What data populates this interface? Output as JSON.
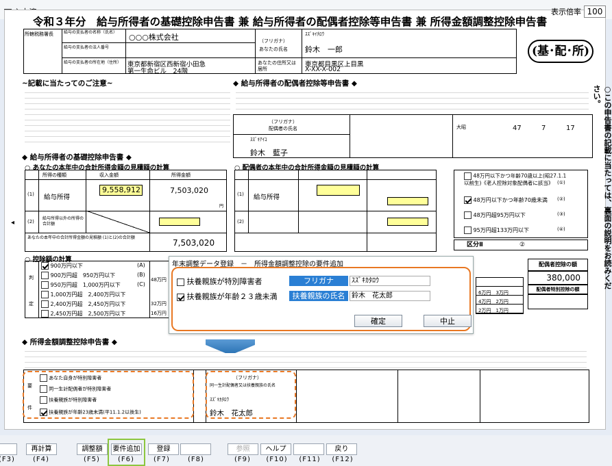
{
  "topbar": {
    "input_done_label": "入力済",
    "zoom_label": "表示倍率",
    "zoom_value": "100"
  },
  "form": {
    "title": "令和３年分　給与所得者の基礎控除申告書 兼 給与所得者の配偶者控除等申告書 兼 所得金額調整控除申告書",
    "badge": "(基･配･所)",
    "office_label": "所轄税務署長",
    "payer_name_label": "給与の支払者の名称（氏名）",
    "payer_name": "○○○株式会社",
    "payer_corp_label": "給与の支払者の法人番号",
    "payer_addr_label": "給与の支払者の所在地（住所）",
    "payer_addr_1": "東京都新宿区西新宿小田急",
    "payer_addr_2": "第一生命ビル　24階",
    "furigana_label": "（フリガナ）",
    "name_label": "あなたの氏名",
    "name_kana": "ｽｽﾞｷｲﾁﾛｳ",
    "name": "鈴木　一郎",
    "your_addr_label": "あなたの住所又は居所",
    "your_addr_1": "東京都目黒区上目黒",
    "your_addr_2": "X-XX-X-002",
    "notes_title": "~記載に当たってのご注意~",
    "spouse_title": "◆ 給与所得者の配偶者控除等申告書 ◆",
    "basic_title": "◆ 給与所得者の基礎控除申告書 ◆",
    "estimate_title": "○ あなたの本年中の合計所得金額の見積額の計算",
    "spouse_estimate_title": "○ 配偶者の本年中の合計所得金額の見積額の計算",
    "income_type_hdr": "所得の種類",
    "revenue_hdr": "収入金額",
    "income_hdr": "所得金額",
    "row1_label": "給与所得",
    "row1_revenue": "9,558,912",
    "row1_income": "7,503,020",
    "row2_label": "給与所得以外の所得の合計額",
    "total_label": "あなたの本年中の合計所得金額の見積額 (1)と(2)の合計額",
    "total_value": "7,503,020",
    "deduction_title": "○ 控除額の計算",
    "deduction_rows": [
      {
        "check": true,
        "text": "900万円以下",
        "mark": "(A)"
      },
      {
        "check": false,
        "text": "900万円超　950万円以下",
        "mark": "(B)"
      },
      {
        "check": false,
        "text": "950万円超　1,000万円以下",
        "mark": "(C)"
      },
      {
        "check": false,
        "text": "1,000万円超　2,400万円以下",
        "mark": ""
      },
      {
        "check": false,
        "text": "2,400万円超　2,450万円以下",
        "mark": ""
      },
      {
        "check": false,
        "text": "2,450万円超　2,500万円以下",
        "mark": ""
      }
    ],
    "deduction_amounts": [
      "48万円",
      "32万円",
      "16万円"
    ],
    "spouse_kana": "ｽｽﾞｷｱｲｺ",
    "spouse_name": "鈴木　藍子",
    "spouse_name_label": "配偶者の氏名",
    "spouse_birth_era": "大昭",
    "spouse_birth_year": "47",
    "spouse_birth_month": "7",
    "spouse_birth_day": "17",
    "spouse_cats": [
      {
        "check": false,
        "text": "48万円以下かつ年齢70歳以上(昭27.1.1以前生)《老人控除対象配偶者に該当》",
        "mark": "(①)"
      },
      {
        "check": true,
        "text": "48万円以下かつ年齢70歳未満",
        "mark": "(②)"
      },
      {
        "check": false,
        "text": "48万円超95万円以下",
        "mark": "(③)"
      },
      {
        "check": false,
        "text": "95万円超133万円以下",
        "mark": "(④)"
      }
    ],
    "kubun_label": "区分Ⅱ",
    "kubun_value": "②",
    "spouse_deduction_label": "配偶者控除の額",
    "spouse_deduction_value": "380,000",
    "spouse_special_label": "配偶者特別控除の額",
    "adj_title": "◆ 所得金額調整控除申告書 ◆",
    "adj_reqs": [
      {
        "check": false,
        "text": "あなた自身が特別障害者"
      },
      {
        "check": false,
        "text": "同一生計配偶者が特別障害者"
      },
      {
        "check": false,
        "text": "扶養親族が特別障害者"
      },
      {
        "check": true,
        "text": "扶養親族が年齢23歳未満(平11.1.2以後生)"
      }
    ],
    "dependent_kana": "ｽｽﾞｷｶﾀﾛｳ",
    "dependent_name": "鈴木　花太郎",
    "dependent_box_label": "同一生計配偶者又は扶養親族の氏名",
    "yen": "円",
    "vertical_note": "○この申告書の記載に当たっては、裏面の説明をお読みください。"
  },
  "dialog": {
    "title": "年末調整データ登録　－　所得金額調整控除の要件追加",
    "opt1_label": "扶養親族が特別障害者",
    "opt1_checked": false,
    "opt1_field_label": "フリガナ",
    "opt1_field_value": "ｽｽﾞｷｶﾀﾛｳ",
    "opt2_label": "扶養親族が年齢２３歳未満",
    "opt2_checked": true,
    "opt2_field_label": "扶養親族の氏名",
    "opt2_field_value": "鈴木　花太郎",
    "ok_label": "確定",
    "cancel_label": "中止"
  },
  "footer": {
    "buttons": [
      {
        "label": "",
        "key": "(F3)"
      },
      {
        "label": "再計算",
        "key": "(F4)"
      },
      {
        "label": "調整額",
        "key": "(F5)"
      },
      {
        "label": "要件追加",
        "key": "(F6)"
      },
      {
        "label": "登録",
        "key": "(F7)"
      },
      {
        "label": "",
        "key": "(F8)"
      },
      {
        "label": "参照",
        "key": "(F9)"
      },
      {
        "label": "ヘルプ",
        "key": "(F10)"
      },
      {
        "label": "",
        "key": "(F11)"
      },
      {
        "label": "戻り",
        "key": "(F12)"
      }
    ]
  },
  "colors": {
    "accent_orange": "#e87722",
    "accent_blue": "#2a7fd4",
    "highlight_green": "#8cc63f",
    "field_yellow": "#ffff99"
  }
}
